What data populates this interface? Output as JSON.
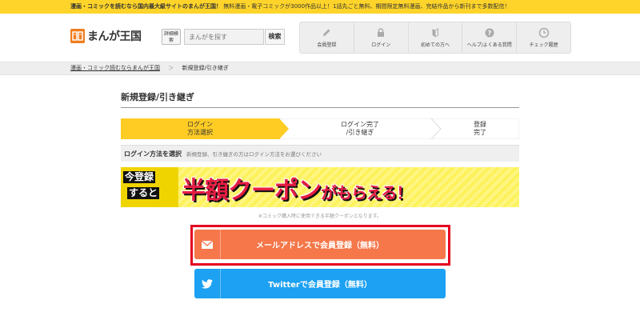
{
  "topbar": {
    "headline": "漫画・コミックを読むなら国内最大級サイトのまんが王国！",
    "detail": "無料漫画・電子コミックが3000作品以上！1話丸ごと無料、期間限定無料漫画、完結作品から新刊まで多数配信！"
  },
  "header": {
    "logo_text": "まんが王国",
    "detail_search_label": "詳細検索",
    "search_placeholder": "まんがを探す",
    "search_button": "検索",
    "nav": [
      {
        "label": "会員登録",
        "icon": "pencil-icon"
      },
      {
        "label": "ログイン",
        "icon": "lock-icon"
      },
      {
        "label": "初めての方へ",
        "icon": "beginner-mark-icon"
      },
      {
        "label": "ヘルプ/よくある質問",
        "icon": "help-icon"
      },
      {
        "label": "チェック履歴",
        "icon": "clock-icon"
      }
    ]
  },
  "breadcrumb": {
    "home": "漫画・コミック読むならまんが王国",
    "separator": "＞",
    "current": "新規登録/引き継ぎ"
  },
  "page": {
    "title": "新規登録/引き継ぎ",
    "steps": [
      {
        "line1": "ログイン",
        "line2": "方法選択",
        "active": true
      },
      {
        "line1": "ログイン完了",
        "line2": "/引き継ぎ",
        "active": false
      },
      {
        "line1": "登録",
        "line2": "完了",
        "active": false
      }
    ],
    "method_title": "ログイン方法を選択",
    "method_desc": "新規登録、引き継ぎの方はログイン方法をお選びください",
    "banner": {
      "badge_line1": "今登録",
      "badge_line2": "すると",
      "main": "半額クーポン",
      "sub": "がもらえる！"
    },
    "coupon_note": "※コミック購入時に使用できる半額クーポンとなります。",
    "buttons": {
      "mail": "メールアドレスで会員登録（無料）",
      "twitter": "Twitterで会員登録（無料）"
    }
  },
  "colors": {
    "topbar": "#ffd42a",
    "step_active": "#ffcc24",
    "mail_button": "#f5774a",
    "twitter_button": "#1da1f2",
    "highlight": "#e5001f",
    "banner_text": "#e61d42"
  }
}
